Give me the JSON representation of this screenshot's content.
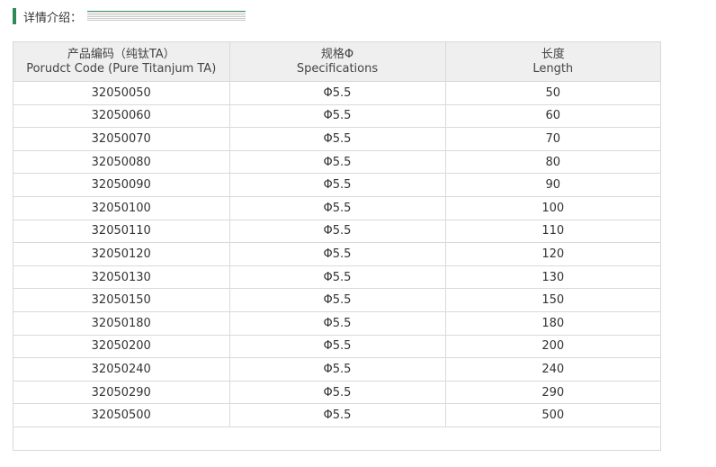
{
  "section": {
    "title": "详情介绍："
  },
  "table": {
    "headers": [
      {
        "line1": "产品编码（纯钛TA）",
        "line2": "Porudct Code (Pure Titanjum TA)"
      },
      {
        "line1": "规格Φ",
        "line2": "Specifications"
      },
      {
        "line1": "长度",
        "line2": "Length"
      }
    ],
    "rows": [
      [
        "32050050",
        "Φ5.5",
        "50"
      ],
      [
        "32050060",
        "Φ5.5",
        "60"
      ],
      [
        "32050070",
        "Φ5.5",
        "70"
      ],
      [
        "32050080",
        "Φ5.5",
        "80"
      ],
      [
        "32050090",
        "Φ5.5",
        "90"
      ],
      [
        "32050100",
        "Φ5.5",
        "100"
      ],
      [
        "32050110",
        "Φ5.5",
        "110"
      ],
      [
        "32050120",
        "Φ5.5",
        "120"
      ],
      [
        "32050130",
        "Φ5.5",
        "130"
      ],
      [
        "32050150",
        "Φ5.5",
        "150"
      ],
      [
        "32050180",
        "Φ5.5",
        "180"
      ],
      [
        "32050200",
        "Φ5.5",
        "200"
      ],
      [
        "32050240",
        "Φ5.5",
        "240"
      ],
      [
        "32050290",
        "Φ5.5",
        "290"
      ],
      [
        "32050500",
        "Φ5.5",
        "500"
      ]
    ]
  }
}
